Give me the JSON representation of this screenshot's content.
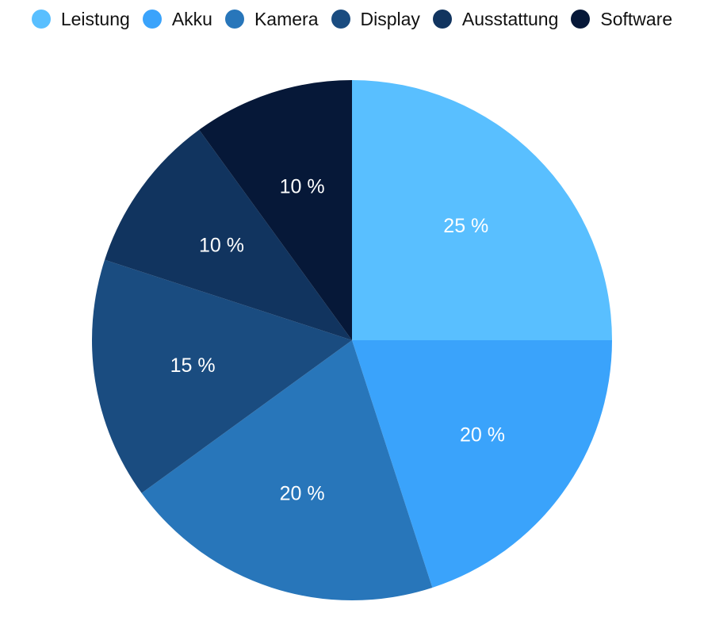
{
  "chart_data": {
    "type": "pie",
    "title": "",
    "categories": [
      "Leistung",
      "Akku",
      "Kamera",
      "Display",
      "Ausstattung",
      "Software"
    ],
    "values": [
      25,
      20,
      20,
      15,
      10,
      10
    ],
    "labels": [
      "25 %",
      "20 %",
      "20 %",
      "15 %",
      "10 %",
      "10 %"
    ],
    "colors": [
      "#59BFFF",
      "#3AA3FB",
      "#2876BA",
      "#1A4C80",
      "#11345F",
      "#061838"
    ],
    "unit": "%",
    "start_angle": "12 o'clock",
    "direction": "clockwise",
    "legend_position": "top"
  },
  "legend": {
    "items": [
      {
        "label": "Leistung",
        "color": "#59BFFF"
      },
      {
        "label": "Akku",
        "color": "#3AA3FB"
      },
      {
        "label": "Kamera",
        "color": "#2876BA"
      },
      {
        "label": "Display",
        "color": "#1A4C80"
      },
      {
        "label": "Ausstattung",
        "color": "#11345F"
      },
      {
        "label": "Software",
        "color": "#061838"
      }
    ]
  }
}
